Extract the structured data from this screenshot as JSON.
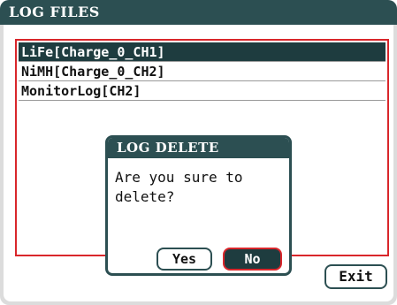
{
  "window": {
    "title": "LOG FILES"
  },
  "file_list": {
    "items": [
      {
        "label": "LiFe[Charge_0_CH1]",
        "selected": true
      },
      {
        "label": "NiMH[Charge_0_CH2]",
        "selected": false
      },
      {
        "label": "MonitorLog[CH2]",
        "selected": false
      }
    ]
  },
  "dialog": {
    "title": "LOG DELETE",
    "message": "Are you sure to delete?",
    "yes_label": "Yes",
    "no_label": "No"
  },
  "footer": {
    "exit_label": "Exit"
  },
  "colors": {
    "title_bar": "#2c4f52",
    "selection": "#1e3c3f",
    "focus_border": "#d9262b",
    "background": "#dcdcdc"
  }
}
